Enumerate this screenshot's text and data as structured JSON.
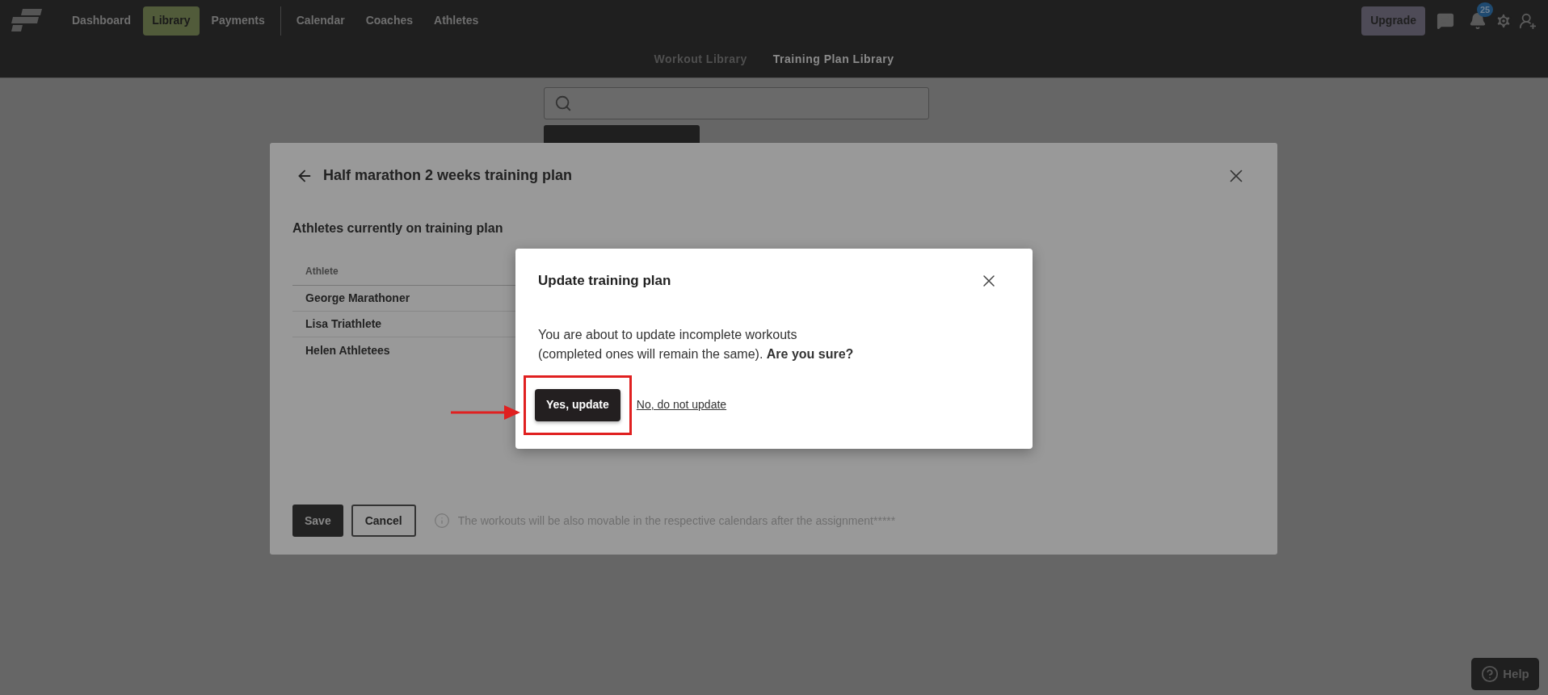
{
  "nav": {
    "groups": [
      [
        {
          "label": "Dashboard",
          "selected": false
        },
        {
          "label": "Library",
          "selected": true
        },
        {
          "label": "Payments",
          "selected": false
        }
      ],
      [
        {
          "label": "Calendar",
          "selected": false
        },
        {
          "label": "Coaches",
          "selected": false
        },
        {
          "label": "Athletes",
          "selected": false
        }
      ]
    ],
    "upgrade_button": "Upgrade",
    "notification_count": "25"
  },
  "sub_tabs": [
    {
      "label": "Workout Library",
      "selected": false
    },
    {
      "label": "Training Plan Library",
      "selected": true
    }
  ],
  "plan_dialog": {
    "title": "Half marathon 2 weeks training plan",
    "section_title": "Athletes currently on training plan",
    "table": {
      "columns": [
        "Athlete"
      ],
      "rows": [
        "George Marathoner",
        "Lisa Triathlete",
        "Helen Athletees"
      ]
    },
    "buttons": [
      "Save",
      "Cancel"
    ],
    "note": "The workouts will be also movable in the respective calendars after the assignment*****"
  },
  "confirm_dialog": {
    "title": "Update training plan",
    "message": "You are about to update incomplete workouts\n(completed ones will remain the same). **Are you sure?**",
    "confirm_button": "Yes, update",
    "cancel_link": "No, do not update"
  },
  "help_button": "Help"
}
